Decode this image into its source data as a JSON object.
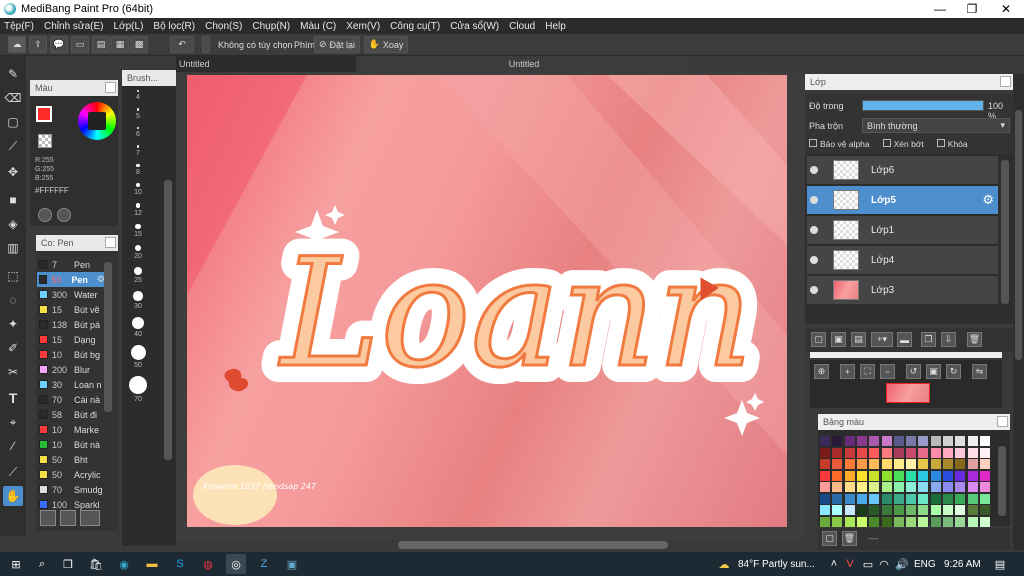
{
  "window": {
    "title": "MediBang Paint Pro (64bit)"
  },
  "menu": [
    "Tệp(F)",
    "Chỉnh sửa(E)",
    "Lớp(L)",
    "Bộ lọc(R)",
    "Chọn(S)",
    "Chụp(N)",
    "Màu (C)",
    "Xem(V)",
    "Công cụ(T)",
    "Cửa sổ(W)",
    "Cloud",
    "Help"
  ],
  "toolbar": {
    "no_selection": "Không có tùy chọn",
    "phim": "Phím",
    "reset": "Đặt lại",
    "rotate": "Xoay"
  },
  "tabs": [
    "Untitled",
    "Untitled"
  ],
  "color_panel": {
    "title": "Màu",
    "r": "R:255",
    "g": "G:255",
    "b": "B:255",
    "hex": "#FFFFFF",
    "fg": "#ff2b2b",
    "bg": "#ffffff"
  },
  "brush_panel": {
    "title": "Co: Pen",
    "sizes_title": "Brush...",
    "items": [
      {
        "size": "7",
        "name": "Pen",
        "color": "#2a2a2a"
      },
      {
        "size": "50",
        "name": "Pen",
        "color": "#2a2a2a",
        "selected": true
      },
      {
        "size": "300",
        "name": "Water",
        "color": "#6fd0ff"
      },
      {
        "size": "15",
        "name": "Bút vẽ",
        "color": "#f6e04a"
      },
      {
        "size": "138",
        "name": "Bút pá",
        "color": "#2a2a2a"
      },
      {
        "size": "15",
        "name": "Dạng",
        "color": "#ff3b3b"
      },
      {
        "size": "10",
        "name": "Bút bg",
        "color": "#ff3b3b"
      },
      {
        "size": "200",
        "name": "Blur",
        "color": "#f7a6ff"
      },
      {
        "size": "30",
        "name": "Loan n",
        "color": "#6fd0ff"
      },
      {
        "size": "70",
        "name": "Cái nà",
        "color": "#2a2a2a"
      },
      {
        "size": "58",
        "name": "Bút đi",
        "color": "#2a2a2a"
      },
      {
        "size": "10",
        "name": "Marke",
        "color": "#ff3b3b"
      },
      {
        "size": "10",
        "name": "Bút nà",
        "color": "#22bb33"
      },
      {
        "size": "50",
        "name": "Bht",
        "color": "#f6e04a"
      },
      {
        "size": "50",
        "name": "Acrylic",
        "color": "#f6e04a"
      },
      {
        "size": "70",
        "name": "Smudg",
        "color": "#dddddd"
      },
      {
        "size": "100",
        "name": "Sparkl",
        "color": "#3a6bff"
      }
    ],
    "size_labels": [
      "4",
      "5",
      "6",
      "7",
      "8",
      "10",
      "12",
      "15",
      "20",
      "25",
      "30",
      "40",
      "50",
      "70"
    ]
  },
  "canvas": {
    "title_text": "Loann",
    "watermark": "Knowme 1037 Hendsap 247"
  },
  "layers_panel": {
    "title": "Lớp",
    "opacity_label": "Độ trong",
    "opacity_value": "100 %",
    "opacity_fraction": 1.0,
    "blend_label": "Pha trộn",
    "blend_value": "Bình thường",
    "protect_alpha": "Bảo vệ alpha",
    "clipping": "Xén bớt",
    "lock": "Khóa",
    "layers": [
      {
        "name": "Lớp6",
        "selected": false
      },
      {
        "name": "Lớp5",
        "selected": true
      },
      {
        "name": "Lớp1",
        "selected": false
      },
      {
        "name": "Lớp4",
        "selected": false
      },
      {
        "name": "Lớp3",
        "selected": false
      }
    ]
  },
  "palette_panel": {
    "title": "Bảng màu",
    "footer": "----"
  },
  "taskbar": {
    "weather": "84°F  Partly sun...",
    "lang": "ENG",
    "time": "9:26 AM"
  }
}
